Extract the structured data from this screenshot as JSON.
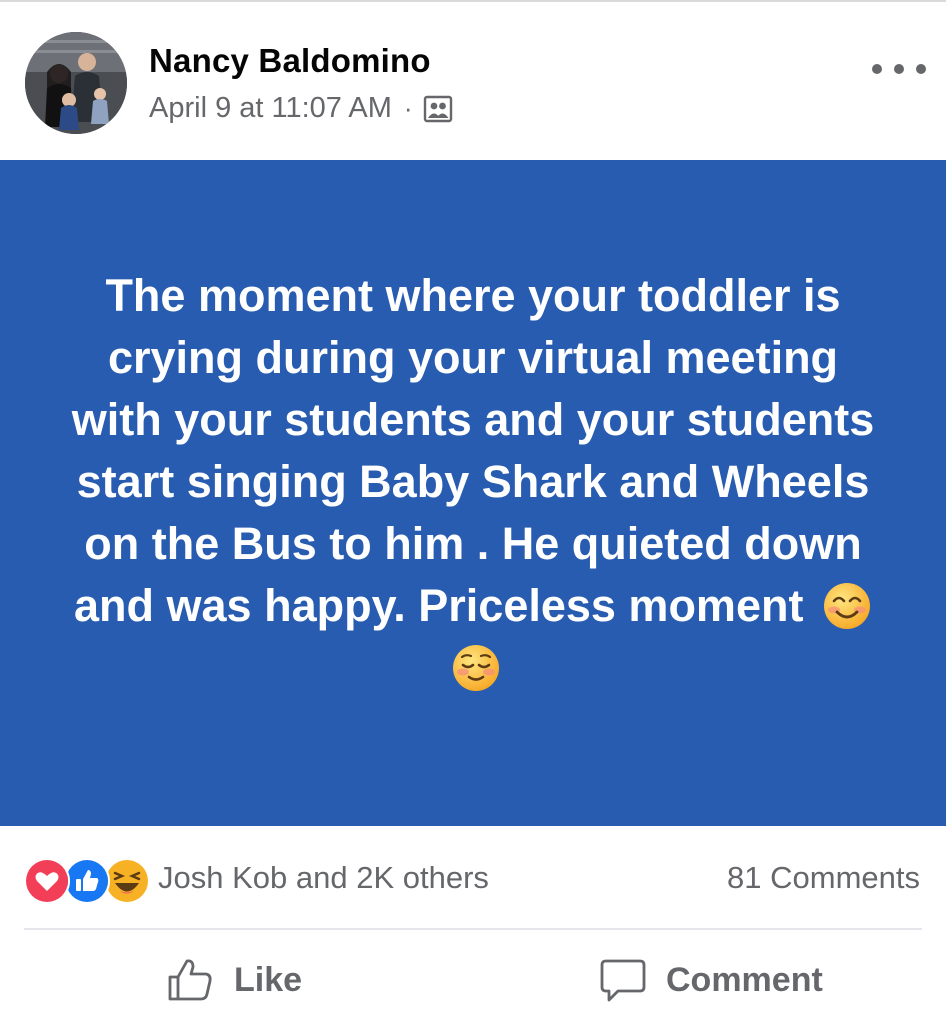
{
  "post": {
    "author": "Nancy Baldomino",
    "timestamp": "April 9 at 11:07 AM",
    "separator": "·",
    "audience_icon": "friends-audience-icon",
    "more_icon": "more-options-icon",
    "text": "The moment where your toddler is crying during your virtual meeting with your students and your students start singing Baby Shark and Wheels on the Bus to him .  He quieted down and was happy.  Priceless moment",
    "emojis": [
      "smiling-face-icon",
      "relieved-face-icon"
    ],
    "background_color": "#285cb0"
  },
  "reactions": {
    "icons": [
      "love-reaction-icon",
      "like-reaction-icon",
      "haha-reaction-icon"
    ],
    "summary": "Josh Kob and 2K others",
    "comments": "81 Comments"
  },
  "actions": {
    "like_label": "Like",
    "comment_label": "Comment"
  }
}
